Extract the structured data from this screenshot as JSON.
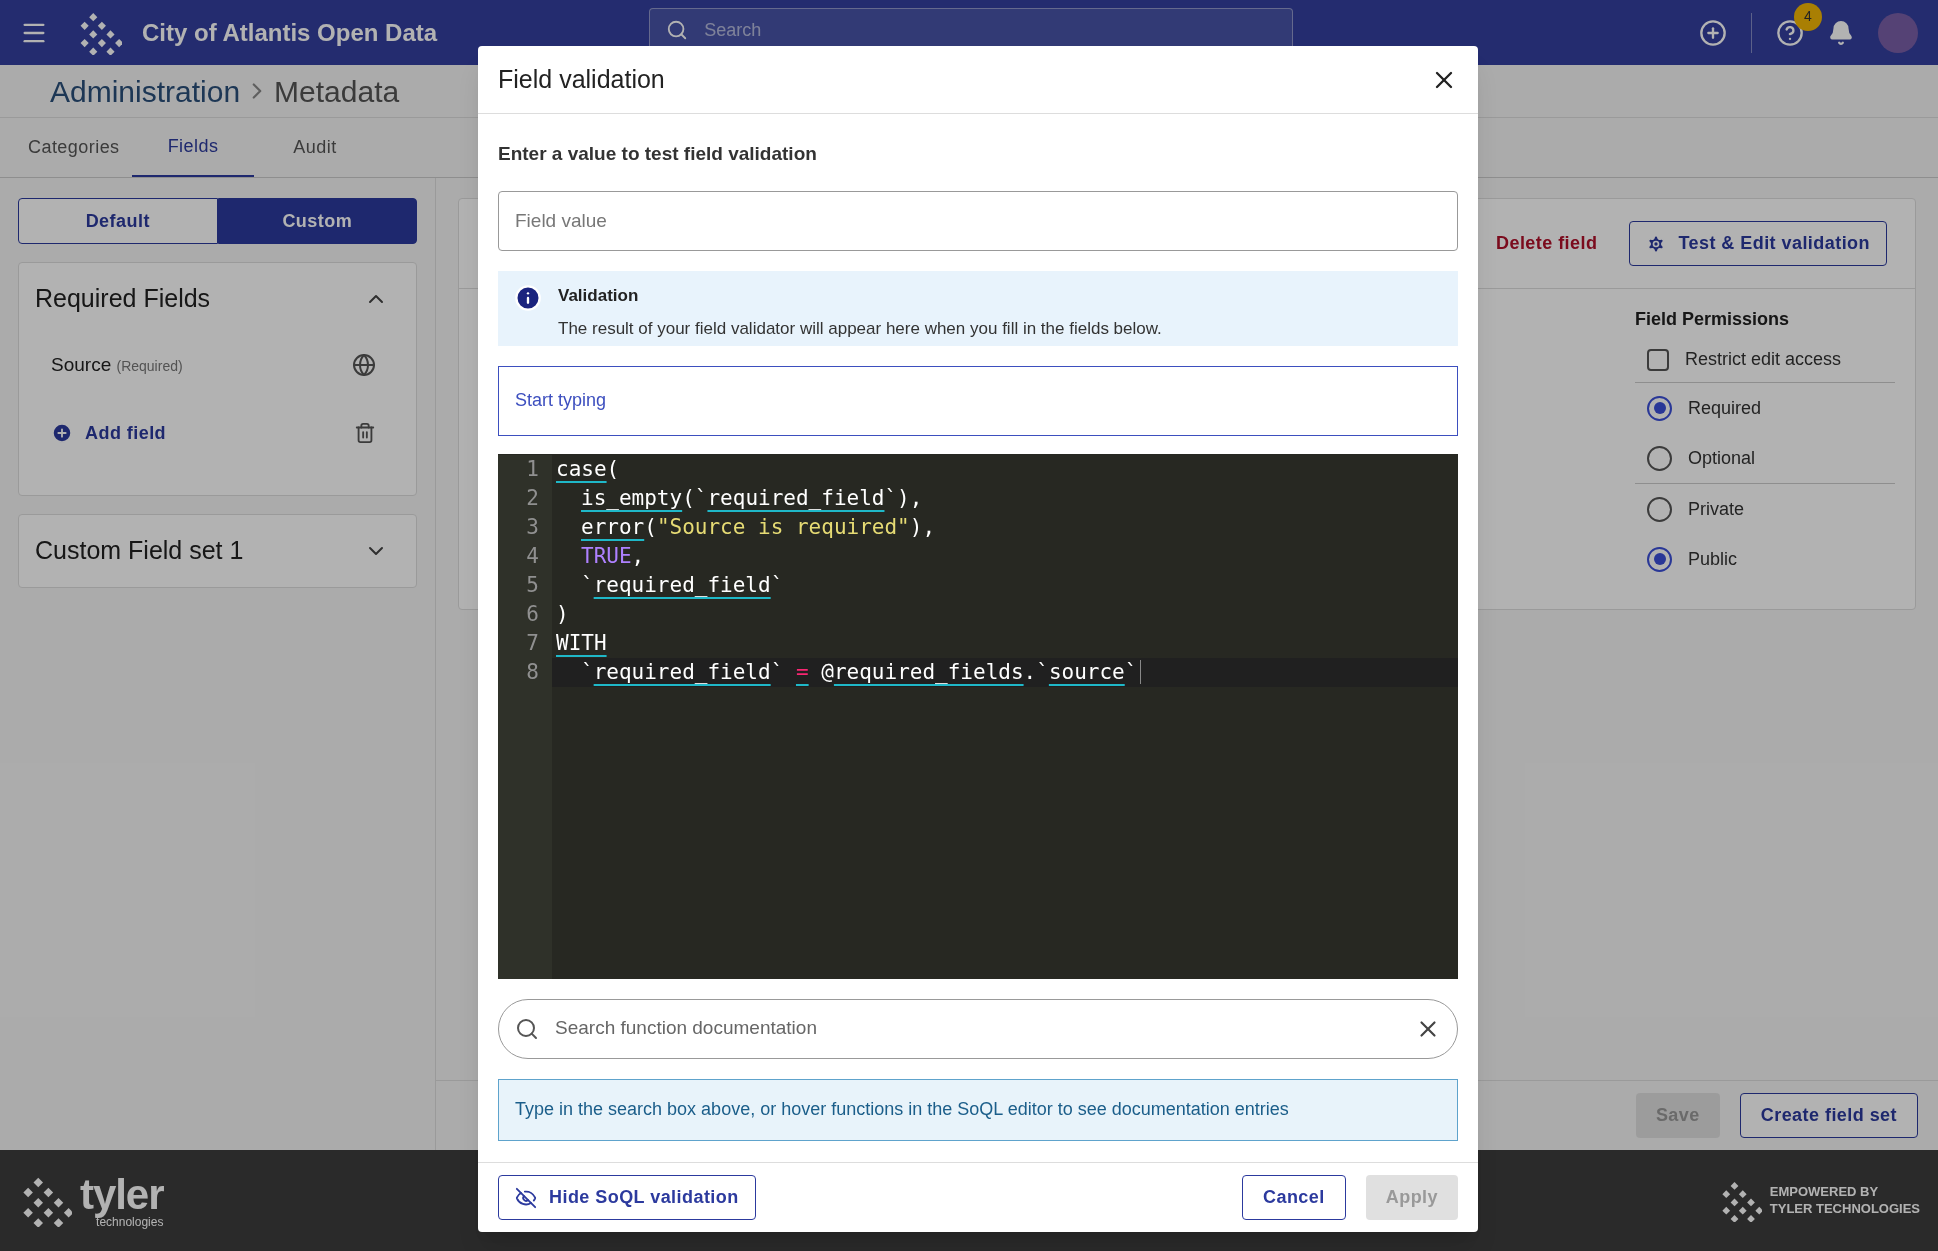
{
  "header": {
    "title": "City of Atlantis Open Data",
    "search_placeholder": "Search",
    "notification_count": "4"
  },
  "breadcrumb": [
    "Administration",
    "Metadata"
  ],
  "tabs": [
    {
      "label": "Categories",
      "selected": false
    },
    {
      "label": "Fields",
      "selected": true
    },
    {
      "label": "Audit",
      "selected": false
    }
  ],
  "segments": [
    {
      "label": "Default",
      "selected": false
    },
    {
      "label": "Custom",
      "selected": true
    }
  ],
  "field_sets": [
    {
      "title": "Required Fields",
      "expanded": true,
      "fields": [
        {
          "name": "Source",
          "note": "(Required)"
        }
      ],
      "add_label": "Add field"
    },
    {
      "title": "Custom Field set 1",
      "expanded": false
    }
  ],
  "detail": {
    "delete_label": "Delete field",
    "test_label": "Test & Edit validation",
    "permissions_title": "Field Permissions",
    "restrict": {
      "label": "Restrict edit access",
      "checked": false
    },
    "access": [
      {
        "label": "Required",
        "selected": true
      },
      {
        "label": "Optional",
        "selected": false
      }
    ],
    "visibility": [
      {
        "label": "Private",
        "selected": false
      },
      {
        "label": "Public",
        "selected": true
      }
    ]
  },
  "bottom_bar": {
    "save_label": "Save",
    "save_disabled": true,
    "create_label": "Create field set"
  },
  "footer": {
    "brand": "tyler",
    "brand_sub": "technologies",
    "powered_line1": "EMPOWERED BY",
    "powered_line2": "TYLER TECHNOLOGIES"
  },
  "dialog": {
    "title": "Field validation",
    "prompt": "Enter a value to test field validation",
    "value_placeholder": "Field value",
    "alert": {
      "title": "Validation",
      "text": "The result of your field validator will appear here when you fill in the fields below."
    },
    "start_placeholder": "Start typing",
    "code": [
      {
        "number": "1",
        "active": false,
        "tokens": [
          {
            "kind": "ident",
            "text": "case"
          },
          {
            "kind": "punct",
            "text": "("
          }
        ]
      },
      {
        "number": "2",
        "active": false,
        "indented": true,
        "tokens": [
          {
            "kind": "ident",
            "text": "is_empty"
          },
          {
            "kind": "punct",
            "text": "(`"
          },
          {
            "kind": "ident",
            "text": "required_field"
          },
          {
            "kind": "punct",
            "text": "`),"
          }
        ]
      },
      {
        "number": "3",
        "active": false,
        "indented": true,
        "tokens": [
          {
            "kind": "ident",
            "text": "error"
          },
          {
            "kind": "punct",
            "text": "("
          },
          {
            "kind": "string",
            "text": "\"Source is required\""
          },
          {
            "kind": "punct",
            "text": "),"
          }
        ]
      },
      {
        "number": "4",
        "active": false,
        "indented": true,
        "tokens": [
          {
            "kind": "constant",
            "text": "TRUE"
          },
          {
            "kind": "punct",
            "text": ","
          }
        ]
      },
      {
        "number": "5",
        "active": false,
        "indented": true,
        "tokens": [
          {
            "kind": "punct",
            "text": "`"
          },
          {
            "kind": "ident",
            "text": "required_field"
          },
          {
            "kind": "punct",
            "text": "`"
          }
        ]
      },
      {
        "number": "6",
        "active": false,
        "tokens": [
          {
            "kind": "punct",
            "text": ")"
          }
        ]
      },
      {
        "number": "7",
        "active": false,
        "tokens": [
          {
            "kind": "ident",
            "text": "WITH"
          }
        ]
      },
      {
        "number": "8",
        "active": true,
        "indented": true,
        "tokens": [
          {
            "kind": "punct",
            "text": "`"
          },
          {
            "kind": "ident",
            "text": "required_field"
          },
          {
            "kind": "punct",
            "text": "` "
          },
          {
            "kind": "operator",
            "text": "="
          },
          {
            "kind": "punct",
            "text": " @"
          },
          {
            "kind": "ident",
            "text": "required_fields"
          },
          {
            "kind": "punct",
            "text": ".`"
          },
          {
            "kind": "ident",
            "text": "source"
          },
          {
            "kind": "punct",
            "text": "`"
          }
        ]
      }
    ],
    "doc_search_placeholder": "Search function documentation",
    "doc_hint": "Type in the search box above, or hover functions in the SoQL editor to see documentation entries",
    "hide_label": "Hide SoQL validation",
    "cancel_label": "Cancel",
    "apply_label": "Apply",
    "apply_disabled": true
  }
}
